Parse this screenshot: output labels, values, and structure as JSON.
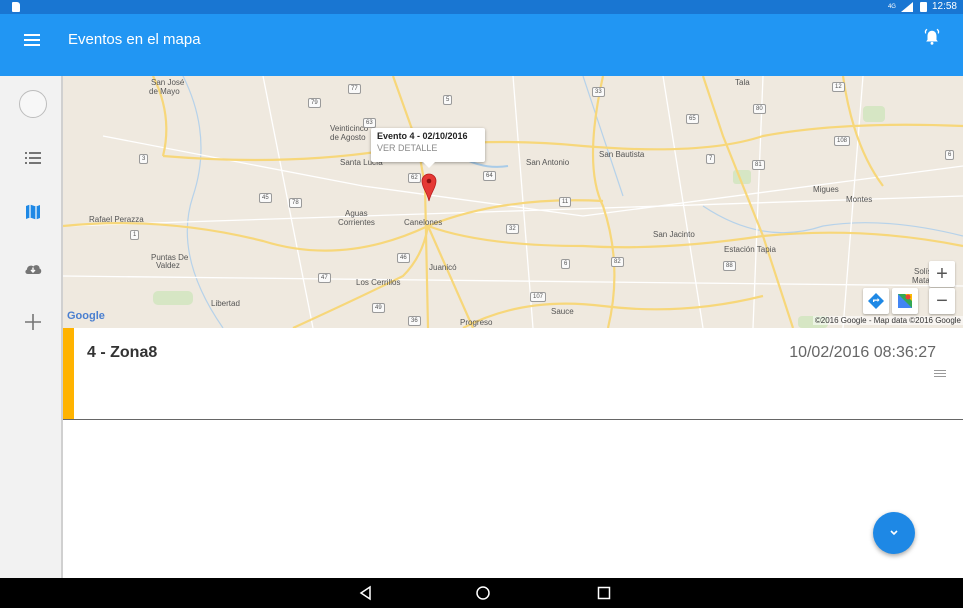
{
  "status_bar": {
    "time": "12:58",
    "signal_label": "4G",
    "icons": [
      "sd-card-icon",
      "signal-icon",
      "battery-icon"
    ]
  },
  "toolbar": {
    "title": "Eventos en el mapa",
    "menu_icon": "menu-icon",
    "action_icon": "alarm-bell-icon",
    "color": "#2196f3"
  },
  "sidebar": {
    "items": [
      {
        "icon": "avatar-circle-icon"
      },
      {
        "icon": "list-icon"
      },
      {
        "icon": "map-icon",
        "active": true
      },
      {
        "icon": "cloud-download-icon"
      },
      {
        "icon": "add-icon"
      }
    ]
  },
  "map": {
    "info_window": {
      "title": "Evento 4 - 02/10/2016",
      "link": "VER DETALLE"
    },
    "places": {
      "san_jose": "San José",
      "de_mayo": "de Mayo",
      "veinticinco1": "Veinticinco",
      "veinticinco2": "de Agosto",
      "santa_lucia": "Santa Lucía",
      "san_antonio": "San Antonio",
      "san_bautista": "San Bautista",
      "tala": "Tala",
      "migues": "Migues",
      "montes": "Montes",
      "rafael": "Rafael Perazza",
      "aguas1": "Aguas",
      "aguas2": "Corrientes",
      "canelones": "Canelones",
      "san_jacinto": "San Jacinto",
      "estacion": "Estación Tapia",
      "puntas1": "Puntas De",
      "puntas2": "Valdez",
      "juanico": "Juanicó",
      "cerrillos": "Los Cerrillos",
      "soli1": "Solís",
      "soli2": "Mataojo",
      "libertad": "Libertad",
      "progreso": "Progreso",
      "sauce": "Sauce"
    },
    "shields": {
      "r77": "77",
      "r79": "79",
      "r5": "5",
      "r33": "33",
      "r12": "12",
      "r80": "80",
      "r65": "65",
      "r63": "63",
      "r108": "108",
      "r3": "3",
      "r7": "7",
      "r81": "81",
      "r6": "6",
      "r62": "62",
      "r64": "64",
      "r45": "45",
      "r78": "78",
      "r11": "11",
      "r1": "1",
      "r32": "32",
      "r46": "46",
      "r88": "88",
      "r82": "82",
      "r47": "47",
      "r107": "107",
      "r49": "49",
      "r36": "36",
      "r6b": "6"
    },
    "google_logo": "Google",
    "attribution": "©2016 Google - Map data ©2016 Google",
    "zoom_in": "+",
    "zoom_out": "−",
    "directions_icon": "directions-icon",
    "maps_app_icon": "google-maps-icon"
  },
  "event": {
    "title": "4 - Zona8",
    "datetime": "10/02/2016 08:36:27",
    "accent_color": "#ffb300",
    "drag_icon": "drag-handle-icon"
  },
  "fab": {
    "icon": "chevron-down-icon",
    "color": "#1e88e5"
  },
  "nav_bar": {
    "back_icon": "back-icon",
    "home_icon": "home-icon",
    "recents_icon": "recents-icon"
  }
}
